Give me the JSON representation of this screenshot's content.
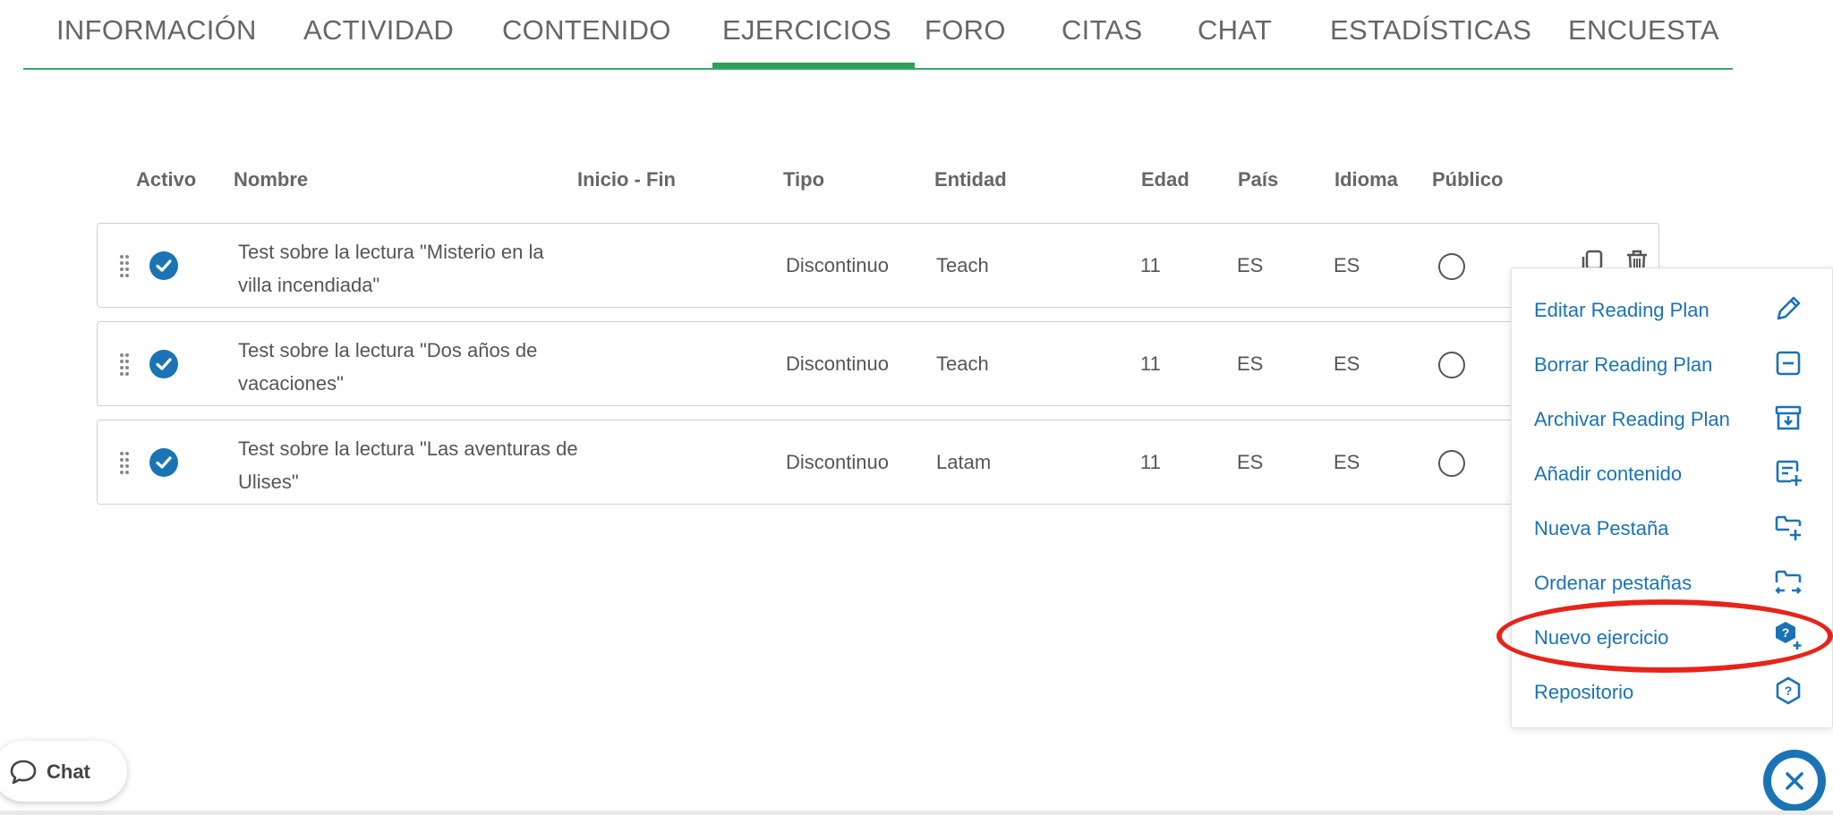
{
  "tabs": [
    {
      "label": "INFORMACIÓN"
    },
    {
      "label": "ACTIVIDAD"
    },
    {
      "label": "CONTENIDO"
    },
    {
      "label": "EJERCICIOS",
      "active": true
    },
    {
      "label": "FORO"
    },
    {
      "label": "CITAS"
    },
    {
      "label": "CHAT"
    },
    {
      "label": "ESTADÍSTICAS"
    },
    {
      "label": "ENCUESTA"
    }
  ],
  "table": {
    "headers": {
      "activo": "Activo",
      "nombre": "Nombre",
      "inicio_fin": "Inicio - Fin",
      "tipo": "Tipo",
      "entidad": "Entidad",
      "edad": "Edad",
      "pais": "País",
      "idioma": "Idioma",
      "publico": "Público"
    },
    "rows": [
      {
        "active": true,
        "name": "Test sobre la lectura \"Misterio en la villa incendiada\"",
        "tipo": "Discontinuo",
        "entidad": "Teach",
        "edad": "11",
        "pais": "ES",
        "idioma": "ES",
        "publico": false
      },
      {
        "active": true,
        "name": "Test sobre la lectura \"Dos años de vacaciones\"",
        "tipo": "Discontinuo",
        "entidad": "Teach",
        "edad": "11",
        "pais": "ES",
        "idioma": "ES",
        "publico": false
      },
      {
        "active": true,
        "name": "Test sobre la lectura \"Las aventuras de Ulises\"",
        "tipo": "Discontinuo",
        "entidad": "Latam",
        "edad": "11",
        "pais": "ES",
        "idioma": "ES",
        "publico": false
      }
    ]
  },
  "menu": {
    "items": [
      {
        "label": "Editar Reading Plan",
        "icon": "pencil-icon"
      },
      {
        "label": "Borrar Reading Plan",
        "icon": "minus-box-icon"
      },
      {
        "label": "Archivar Reading Plan",
        "icon": "archive-icon"
      },
      {
        "label": "Añadir contenido",
        "icon": "add-content-icon"
      },
      {
        "label": "Nueva Pestaña",
        "icon": "new-tab-icon"
      },
      {
        "label": "Ordenar pestañas",
        "icon": "reorder-tabs-icon"
      },
      {
        "label": "Nuevo ejercicio",
        "icon": "new-exercise-icon",
        "highlighted": true
      },
      {
        "label": "Repositorio",
        "icon": "repository-icon"
      }
    ]
  },
  "chat_widget": {
    "label": "Chat"
  },
  "colors": {
    "accent": "#1a73b5",
    "tab_underline": "#2f9e58",
    "annotation": "#e8231a"
  }
}
